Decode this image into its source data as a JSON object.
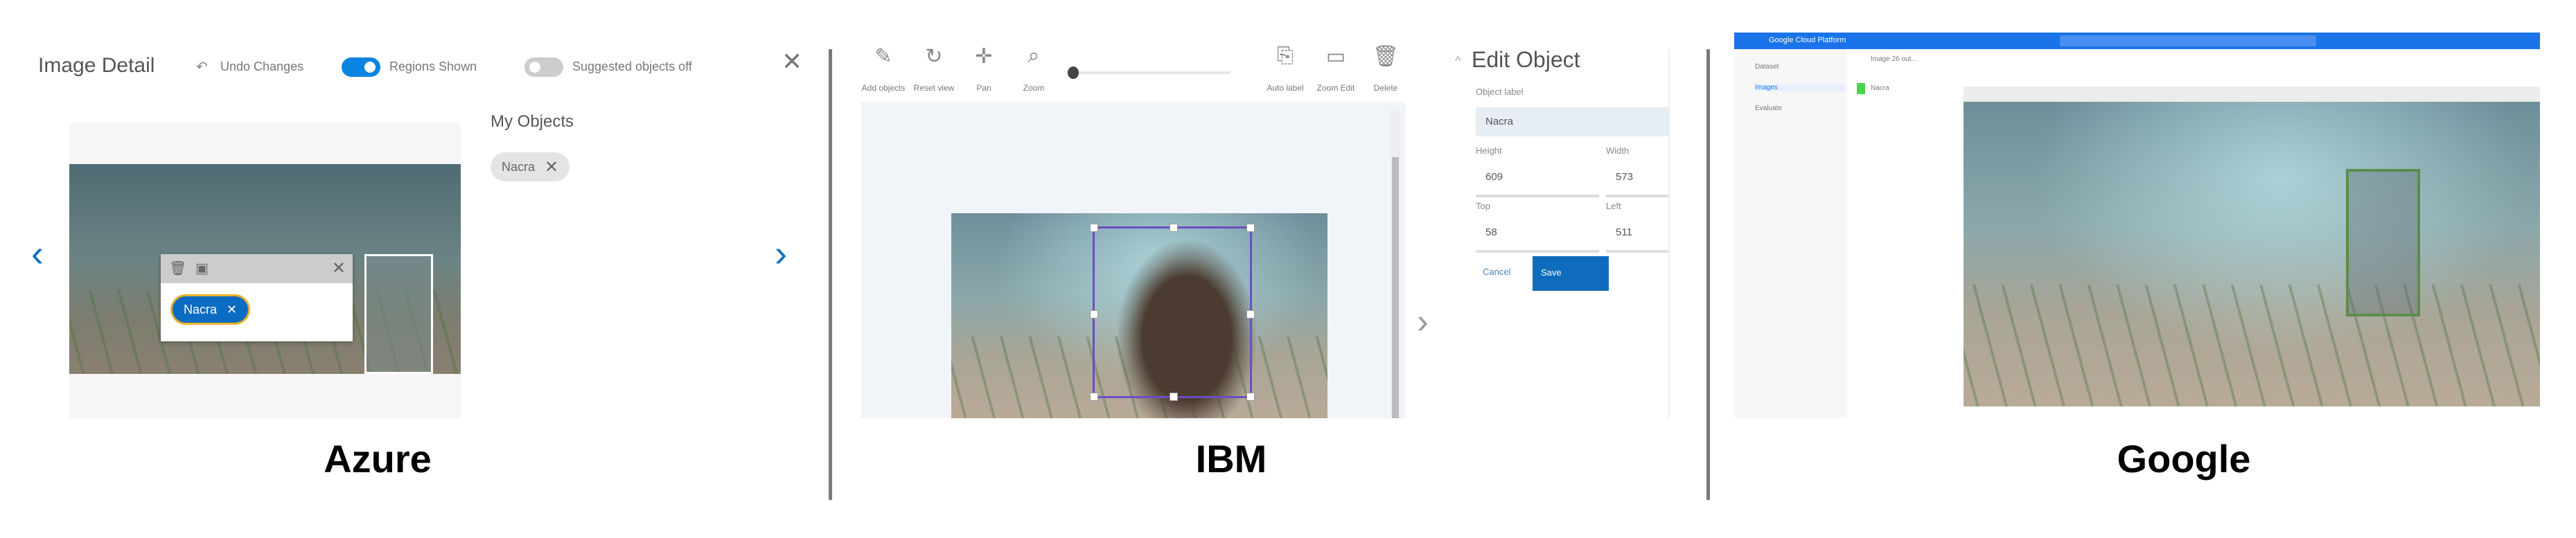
{
  "captions": {
    "azure": "Azure",
    "ibm": "IBM",
    "google": "Google"
  },
  "azure": {
    "title": "Image Detail",
    "undo_label": "Undo Changes",
    "regions_label": "Regions Shown",
    "suggested_label": "Suggested objects off",
    "regions_on": true,
    "suggested_on": false,
    "my_objects_title": "My Objects",
    "object_tag": "Nacra",
    "popup_tag": "Nacra",
    "accent": "#0a84e0"
  },
  "ibm": {
    "toolbar": [
      "Add objects",
      "Reset view",
      "Pan",
      "Zoom",
      "Auto label",
      "Zoom Edit",
      "Delete"
    ],
    "zoom_level": 0.1,
    "panel_title": "Edit Object",
    "object_label_label": "Object label",
    "object_label_value": "Nacra",
    "height_label": "Height",
    "height_value": "609",
    "width_label": "Width",
    "width_value": "573",
    "top_label": "Top",
    "top_value": "58",
    "left_label": "Left",
    "left_value": "511",
    "cancel_label": "Cancel",
    "save_label": "Save",
    "accent": "#0f6cbd"
  },
  "google": {
    "app_title": "Google Cloud Platform",
    "nav": [
      "Dataset",
      "Images",
      "Evaluate"
    ],
    "breadcrumb": "Image 26 out...",
    "label": "Nacra"
  }
}
